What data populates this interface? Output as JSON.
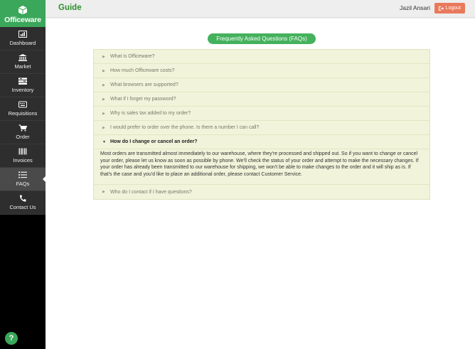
{
  "brand": {
    "name": "Officeware"
  },
  "sidebar": {
    "items": [
      {
        "label": "Dashboard",
        "icon": "bar-chart-icon"
      },
      {
        "label": "Market",
        "icon": "bank-icon"
      },
      {
        "label": "Inventory",
        "icon": "inventory-icon"
      },
      {
        "label": "Requisitions",
        "icon": "keyboard-icon"
      },
      {
        "label": "Order",
        "icon": "cart-icon"
      },
      {
        "label": "Invoices",
        "icon": "barcode-icon"
      },
      {
        "label": "FAQs",
        "icon": "list-icon",
        "active": true
      },
      {
        "label": "Contact Us",
        "icon": "phone-icon"
      }
    ],
    "help_label": "?"
  },
  "header": {
    "title": "Guide",
    "user": "Jazil Ansari",
    "logout_label": "Logout"
  },
  "faq": {
    "heading": "Frequently Asked Questions (FAQs)",
    "items": [
      {
        "question": "What is Officeware?"
      },
      {
        "question": "How much Officeware costs?"
      },
      {
        "question": "What browsers are supported?"
      },
      {
        "question": "What if I forget my password?"
      },
      {
        "question": "Why is sales tax added to my order?"
      },
      {
        "question": "I would prefer to order over the phone. Is there a number I can call?"
      },
      {
        "question": "How do I change or cancel an order?",
        "open": true,
        "answer": "Most orders are transmitted almost immediately to our warehouse, where they're processed and shipped out. So if you want to change or cancel your order, please let us know as soon as possible by phone. We'll check the status of your order and attempt to make the necessary changes. If your order has already been transmitted to our warehouse for shipping, we won't be able to make changes to the order and it will ship as is. If that's the case and you'd like to place an additional order, please contact Customer Service."
      },
      {
        "question": "Who do I contact if I have questions?"
      }
    ]
  },
  "colors": {
    "brand_green": "#3aa75a",
    "logout": "#e9795b",
    "faq_bg": "#f1f3da"
  }
}
